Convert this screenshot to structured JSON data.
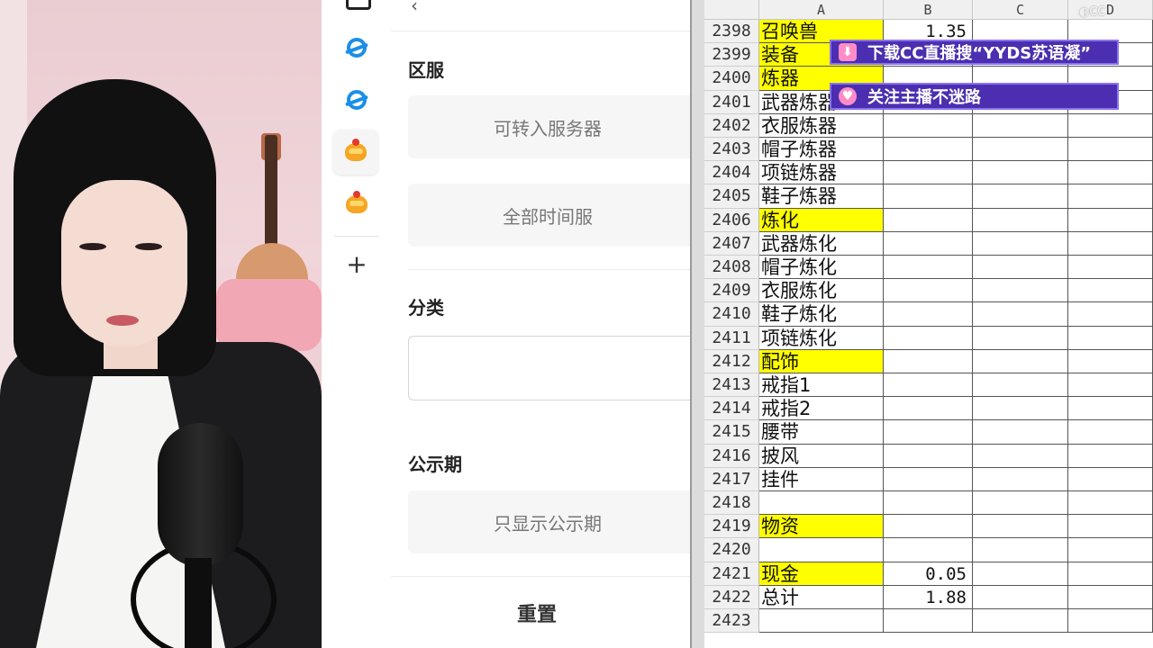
{
  "panel": {
    "section1_title": "区服",
    "opt_transfer": "可转入服务器",
    "opt_alltime": "全部时间服",
    "section2_title": "分类",
    "category_value": "",
    "section3_title": "公示期",
    "opt_public": "只显示公示期",
    "reset": "重置"
  },
  "sidebar": {
    "icons": [
      "browser-icon",
      "browser-icon",
      "game-bird-icon",
      "game-bird-icon",
      "plus-icon"
    ]
  },
  "sheet": {
    "columns": [
      "A",
      "B",
      "C",
      "D"
    ],
    "rows": [
      {
        "n": "2398",
        "a": "召唤兽",
        "b": "1.35",
        "hl": true
      },
      {
        "n": "2399",
        "a": "装备",
        "b": "",
        "hl": true
      },
      {
        "n": "2400",
        "a": "炼器",
        "b": "",
        "hl": true
      },
      {
        "n": "2401",
        "a": "武器炼器",
        "b": "",
        "hl": false
      },
      {
        "n": "2402",
        "a": "衣服炼器",
        "b": "",
        "hl": false
      },
      {
        "n": "2403",
        "a": "帽子炼器",
        "b": "",
        "hl": false
      },
      {
        "n": "2404",
        "a": "项链炼器",
        "b": "",
        "hl": false
      },
      {
        "n": "2405",
        "a": "鞋子炼器",
        "b": "",
        "hl": false
      },
      {
        "n": "2406",
        "a": "炼化",
        "b": "",
        "hl": true
      },
      {
        "n": "2407",
        "a": "武器炼化",
        "b": "",
        "hl": false
      },
      {
        "n": "2408",
        "a": "帽子炼化",
        "b": "",
        "hl": false
      },
      {
        "n": "2409",
        "a": "衣服炼化",
        "b": "",
        "hl": false
      },
      {
        "n": "2410",
        "a": "鞋子炼化",
        "b": "",
        "hl": false
      },
      {
        "n": "2411",
        "a": "项链炼化",
        "b": "",
        "hl": false
      },
      {
        "n": "2412",
        "a": "配饰",
        "b": "",
        "hl": true
      },
      {
        "n": "2413",
        "a": "戒指1",
        "b": "",
        "hl": false
      },
      {
        "n": "2414",
        "a": "戒指2",
        "b": "",
        "hl": false
      },
      {
        "n": "2415",
        "a": "腰带",
        "b": "",
        "hl": false
      },
      {
        "n": "2416",
        "a": "披风",
        "b": "",
        "hl": false
      },
      {
        "n": "2417",
        "a": "挂件",
        "b": "",
        "hl": false
      },
      {
        "n": "2418",
        "a": "",
        "b": "",
        "hl": false
      },
      {
        "n": "2419",
        "a": "物资",
        "b": "",
        "hl": true
      },
      {
        "n": "2420",
        "a": "",
        "b": "",
        "hl": false
      },
      {
        "n": "2421",
        "a": "现金",
        "b": "0.05",
        "hl": true
      },
      {
        "n": "2422",
        "a": "总计",
        "b": "1.88",
        "hl": false
      },
      {
        "n": "2423",
        "a": "",
        "b": "",
        "hl": false
      }
    ]
  },
  "overlay": {
    "banner1": "下载CC直播搜“YYDS苏语凝”",
    "banner2": "关注主播不迷路",
    "banner1_icon": "download-icon",
    "banner2_icon": "heart-icon",
    "accent": "#4b2fb0",
    "highlight": "#ffff00"
  }
}
